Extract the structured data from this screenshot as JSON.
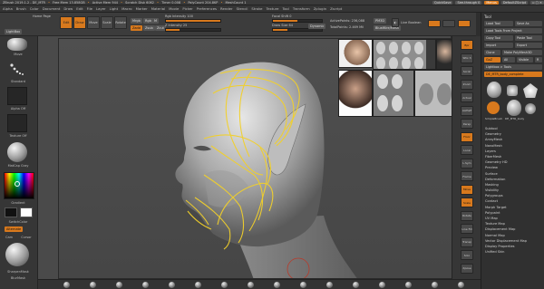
{
  "app": {
    "title": "ZBrush 2019.1.2 - DE_MTR",
    "title_items": [
      "Free Mem 13.858GB",
      "Active Mem 944",
      "Scratch Disk 6062",
      "Timer 0.008",
      "PolyCount 204.8KP",
      "MeshCount 1"
    ],
    "quicksave": "QuickSave",
    "see_through": "See-through 0",
    "menus_btn": "Menus",
    "default_script": "DefaultZScript"
  },
  "menubar": [
    "Alpha",
    "Brush",
    "Color",
    "Document",
    "Draw",
    "Edit",
    "File",
    "Layer",
    "Light",
    "Macro",
    "Marker",
    "Material",
    "Movie",
    "Picker",
    "Preferences",
    "Render",
    "Stencil",
    "Stroke",
    "Texture",
    "Tool",
    "Transform",
    "Zplugin",
    "Zscript"
  ],
  "toolbar": {
    "home_label": "Home Page",
    "buttons": [
      "Edit",
      "Draw",
      "Move",
      "Scale",
      "Rotate"
    ],
    "mrgb": "Mrgb",
    "rgb": "Rgb",
    "m": "M",
    "zadd": "Zadd",
    "zsub": "Zsub",
    "zcut": "Zcut",
    "rgb_intensity": "Rgb Intensity 100",
    "z_intensity": "Z Intensity 25",
    "focal_shift": "Focal Shift 0",
    "draw_size": "Draw Size 64",
    "dynamic": "Dynamic",
    "active_points": "ActivePoints: 236,088",
    "total_points": "TotalPoints: 2.469 Mil",
    "pm3d": "PM3D",
    "ghost_mode": "BlueWire/Mesh",
    "live_boolean": "Live Boolean",
    "intensity_rgb": 1.0,
    "intensity_z": 0.25,
    "focal": 0.5,
    "size": 0.3
  },
  "leftpanel": {
    "lightbox": "LightBox",
    "items": [
      "Move",
      "Standard",
      "Alpha Off",
      "Texture Off",
      "MatCap Gray",
      "Gradient",
      "SwitchColor",
      "Alternate"
    ],
    "sharpen": "SharpenMask",
    "blur": "BlurMask",
    "cam": "Cam",
    "cursor": "Cursor"
  },
  "rightshelf": [
    "Bpr",
    "SPix 3",
    "Scroll",
    "Zoom",
    "Actual",
    "AAHalf",
    "Persp",
    "Floor",
    "Local",
    "L.Sym",
    "Frame",
    "Move",
    "Scale",
    "Rotate",
    "Line Fill",
    "Transp",
    "Solo",
    "Xpose"
  ],
  "tray": {
    "header": "Tool",
    "buttons": [
      "Load Tool",
      "Save As",
      "Load Tools From Project",
      "Copy Tool",
      "Paste Tool",
      "Import",
      "Export",
      "Clone",
      "Make PolyMesh3D",
      "GoZ",
      "All",
      "Visible",
      "R",
      "Lightbox > Tools",
      "DE_MTR_body_complete"
    ],
    "r_value": "R",
    "subtools": [
      "SimpleBrush",
      "Cylinder3D",
      "PolyMesh3D",
      "DE_MTR_body",
      "SimpleBrush"
    ],
    "list": [
      "Subtool",
      "Geometry",
      "ArrayMesh",
      "NanoMesh",
      "Layers",
      "FiberMesh",
      "Geometry HD",
      "Preview",
      "Surface",
      "Deformation",
      "Masking",
      "Visibility",
      "Polygroups",
      "Contact",
      "Morph Target",
      "Polypaint",
      "UV Map",
      "Texture Map",
      "Displacement Map",
      "Normal Map",
      "Vector Displacement Map",
      "Display Properties",
      "Unified Skin"
    ]
  },
  "colors": {
    "accent": "#d8791d",
    "background": "#2e2e2e",
    "curve": "#f2d02a"
  }
}
